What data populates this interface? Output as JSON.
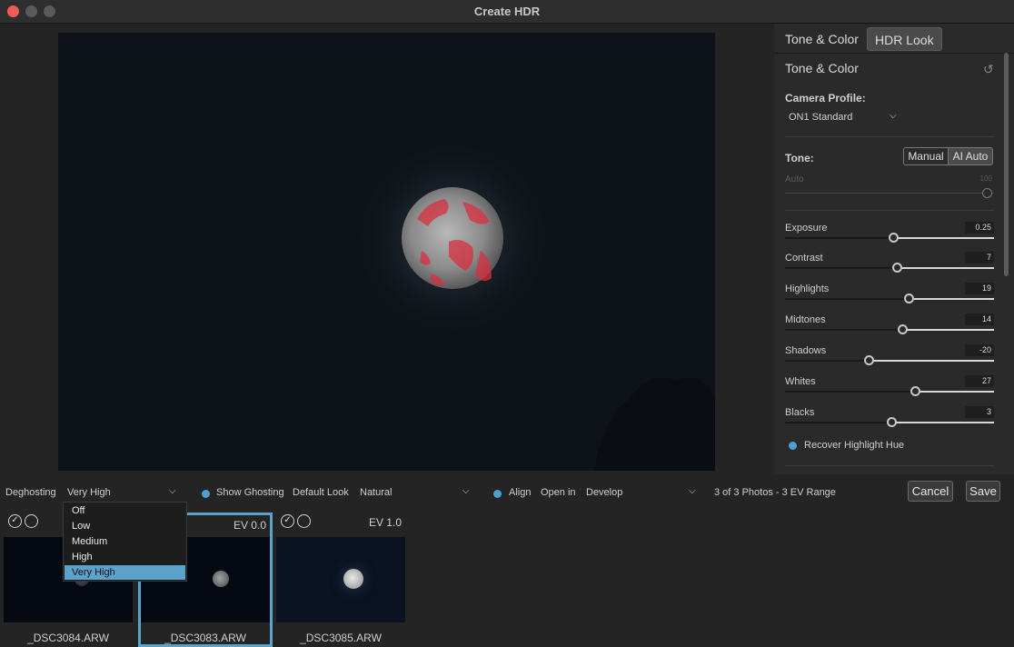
{
  "window": {
    "title": "Create HDR"
  },
  "panel": {
    "tabs": [
      {
        "label": "Tone & Color"
      },
      {
        "label": "HDR Look"
      }
    ],
    "section_title": "Tone & Color",
    "camera_profile_label": "Camera Profile:",
    "camera_profile_value": "ON1 Standard",
    "tone_label": "Tone:",
    "tone_modes": [
      "Manual",
      "AI Auto"
    ],
    "auto_label": "Auto",
    "auto_value": "100",
    "sliders": [
      {
        "label": "Exposure",
        "value": "0.25",
        "fraction": 0.52
      },
      {
        "label": "Contrast",
        "value": "7",
        "fraction": 0.535
      },
      {
        "label": "Highlights",
        "value": "19",
        "fraction": 0.595
      },
      {
        "label": "Midtones",
        "value": "14",
        "fraction": 0.565
      },
      {
        "label": "Shadows",
        "value": "-20",
        "fraction": 0.4
      },
      {
        "label": "Whites",
        "value": "27",
        "fraction": 0.625
      },
      {
        "label": "Blacks",
        "value": "3",
        "fraction": 0.51
      }
    ],
    "recover_label": "Recover Highlight Hue"
  },
  "bottom": {
    "deghosting_label": "Deghosting",
    "deghosting_value": "Very High",
    "show_ghosting_label": "Show Ghosting",
    "default_look_label": "Default Look",
    "default_look_value": "Natural",
    "align_label": "Align",
    "open_in_label": "Open in",
    "open_in_value": "Develop",
    "summary": "3 of 3 Photos - 3 EV Range",
    "cancel_label": "Cancel",
    "save_label": "Save"
  },
  "dropdown": {
    "options": [
      "Off",
      "Low",
      "Medium",
      "High",
      "Very High"
    ],
    "selected": "Very High"
  },
  "thumbnails": [
    {
      "name": "_DSC3084.ARW",
      "ev": ""
    },
    {
      "name": "_DSC3083.ARW",
      "ev": "EV 0.0"
    },
    {
      "name": "_DSC3085.ARW",
      "ev": "EV 1.0"
    }
  ],
  "colors": {
    "accent": "#5ba3cc",
    "selection_border": "#5ba3cc",
    "ghost_overlay": "#d83040"
  }
}
